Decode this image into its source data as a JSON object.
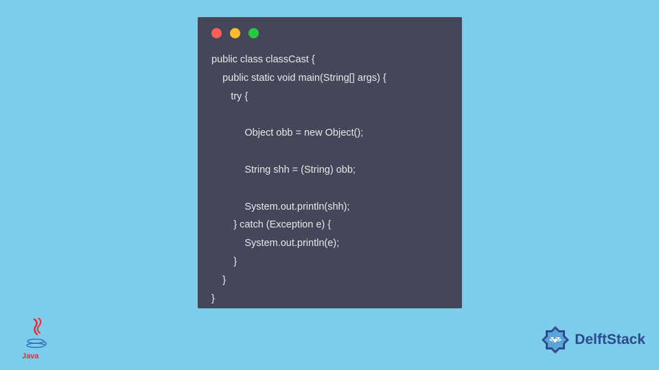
{
  "code": {
    "lines": [
      "public class classCast {",
      "    public static void main(String[] args) {",
      "       try {",
      "",
      "            Object obb = new Object();",
      "",
      "            String shh = (String) obb;",
      "",
      "            System.out.println(shh);",
      "        } catch (Exception e) {",
      "            System.out.println(e);",
      "        }",
      "    }",
      "}"
    ]
  },
  "logos": {
    "java_text": "Java",
    "delft_text": "DelftStack"
  },
  "window_controls": {
    "red": "#FF5F56",
    "yellow": "#FFBD2E",
    "green": "#27C93F"
  }
}
